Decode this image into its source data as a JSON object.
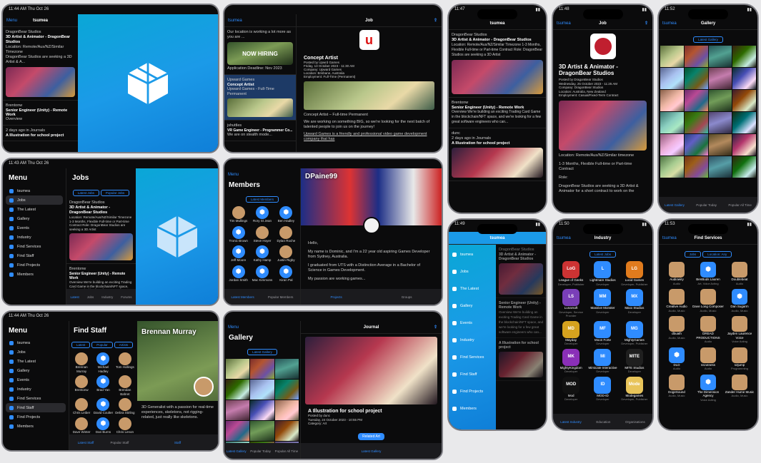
{
  "app": {
    "name": "tsumea",
    "accent": "#2f8cff",
    "ipad_time": "11:44 AM",
    "ipad_date": "Thu Oct 26",
    "jobs_time": "11:43 AM"
  },
  "feed": {
    "back": "Menu",
    "title": "tsumea",
    "job_author": "DragonBear Studios",
    "job_time": "1 day ago in Jobs",
    "job_title": "3D Artist & Animator - DragonBear Studios",
    "job_snip1": "Location: Remote/Aus/NZ/Similar Timezone",
    "job_snip2": "1-3 Months, Flexible Full-time or Part-time Contract",
    "job_snip3": "Role:",
    "job_snip4": "DragonBear Studios are seeking a 3D Artist",
    "job_snip5": "DragonBear Studios are seeking a 3D Artist & A...",
    "job2_author": "Brentonw",
    "job2_time": "1 day ago in Jobs",
    "job2_title": "Senior Engineer (Unity) - Remote Work",
    "job2_snip": "Overview",
    "job2_snip2": "We're building an exciting Trading Card Game in the blockchain/NFT space, and we're looking for a few great software engineers who can...",
    "illus_time": "2 days ago in Journals",
    "illus_title": "A Illustration for school project"
  },
  "job_detail": {
    "back": "tsumea",
    "title": "Job",
    "heading": "Concept Artist",
    "posted": "Posted by Upwrd Games",
    "date": "Friday, 13 October 2023 - 11:30 AM",
    "company": "Company: Upward Games",
    "location": "Location: Brisbane, Australia",
    "type": "Role Type: Full-Time",
    "employment": "Employment: Full-Time (Permanent)",
    "exp": "Experience: Senior",
    "line1": "Concept Artist – Full-time Permanent",
    "line2": "We are working on something BIG, so we're looking for the next batch of talented people to join us on the journey!",
    "line3": "Upward Games is a friendly and professional video game development company that has"
  },
  "job_feed_mid": {
    "snip1": "Our location is working a lot more as you are ...",
    "hiring": "NOW HIRING",
    "app_title": "Application Deadline: Nov 2023",
    "app_author": "hopepupp",
    "concept_title": "Concept Artist",
    "concept_sub": "Upward Games",
    "concept_snip": "Upward Games - Full-Time Permanent",
    "vr_author": "jshuttles",
    "vr_title": "VR Game Engineer - Programmer Co...",
    "vr_snip": "We are on stealth mode..."
  },
  "phone_feed": {
    "time": "11:47",
    "title": "tsumea",
    "job_author": "DragonBear Studios",
    "job_time": "1 day ago in Jobs",
    "job_title": "3D Artist & Animator - DragonBear Studios",
    "job_snip": "Location: Remote/Aus/NZ/Similar Timezone  1-3 Months, Flexible Full-time or Part-time Contract  Role:  DragonBear Studios are seeking a 3D Artist",
    "job2_author": "Brentonw",
    "job2_time": "1 day ago in Jobs",
    "job2_title": "Senior Engineer (Unity) - Remote Work",
    "job2_snip": "Overview  We're building an exciting Trading Card Game in the blockchain/NFT space, and we're looking for a few great software engineers who can...",
    "illus_author": "dunc",
    "illus_time": "2 days ago in Journals",
    "illus_title": "A Illustration for school project",
    "foot": "Jobs"
  },
  "phone_job": {
    "time": "11:48",
    "back": "tsumea",
    "title": "Job",
    "heading": "3D Artist & Animator - DragonBear Studios",
    "posted": "Posted by DragonBear Studios",
    "date": "Wednesday, 25 October 2023 - 11:25 AM",
    "company": "Company: DragonBear Studios",
    "location": "Location: Australia, New Zealand",
    "duration": "Duration: 1-3 Months",
    "employment": "Employment: Casual/Fixed-Term Contract",
    "skills": "Skills: 3D Art, Animation",
    "exp": "Experience: Mid-Level, Junior, Senior",
    "l1": "Location: Remote/Aus/NZ/Similar timezone",
    "l2": "1-3 Months, Flexible Full-time or Part-time Contract",
    "l3": "Role:",
    "l4": "DragonBear Studios are seeking a 3D Artist & Animator for a short contract to work on the"
  },
  "phone_gallery": {
    "time": "11:52",
    "back": "tsumea",
    "title": "Gallery",
    "seg": "Latest Gallery",
    "tabs": [
      "Latest Gallery",
      "Popular Today",
      "Popular All Time"
    ]
  },
  "ipad_menu": {
    "title": "Menu",
    "items": [
      "tsumea",
      "Jobs",
      "The Latest",
      "Gallery",
      "Events",
      "Industry",
      "Find Services",
      "Find Staff",
      "Find Projects",
      "Members"
    ]
  },
  "jobs_list": {
    "title": "Jobs",
    "segs": [
      "Latest Jobs",
      "Popular Jobs"
    ],
    "author": "DragonBear Studios",
    "job_title": "3D Artist & Animator - DragonBear Studios",
    "snip": "Location: Remote/Aus/NZ/Similar Timezone  1-3 Months, Flexible Full-time or Part-time Contract  Role:  DragonBear Studios are seeking a 3D Artist",
    "author2": "Brentonw",
    "job2_title": "Senior Engineer (Unity) - Remote Work",
    "snip2": "Overview  We're building an exciting Trading Card Game in the blockchain/NFT space, and we're looking for a few great software engineers",
    "tabs": [
      "Latest",
      "Jobs",
      "Industry",
      "Forums",
      "Education"
    ]
  },
  "members": {
    "back": "Menu",
    "title": "Members",
    "seg": "Latest Members",
    "people": [
      "Tim Mullings",
      "Rory St Jean",
      "Ben Hadley",
      "Tronic Brown",
      "Steve Hoyer",
      "Dylan Roche",
      "Jeff Moore",
      "Kathy Hamp",
      "Justin Rigby",
      "Jordan Smith",
      "Mac Kimmons",
      "Kiran Pal"
    ],
    "hero_name": "DPaine99",
    "hello": "Hello,",
    "bio1": "My name is Dominic, and I'm a 22 year old aspiring Games Developer from Sydney, Australia.",
    "bio2": "I graduated from UTS with a Distinction Average in a Bachelor of Science in Games Development.",
    "bio3": "My passion are working games...",
    "tabs": [
      "Latest Members",
      "Popular Members",
      "Projects",
      "Groups"
    ]
  },
  "phone_menu": {
    "time": "11:49",
    "title": "tsumea",
    "items": [
      "tsumea",
      "Jobs",
      "The Latest",
      "Gallery",
      "Events",
      "Industry",
      "Find Services",
      "Find Staff",
      "Find Projects",
      "Members"
    ]
  },
  "phone_industry": {
    "time": "11:50",
    "back": "tsumea",
    "title": "Industry",
    "seg": "Latest Jobs",
    "items": [
      {
        "name": "League of Geeks",
        "sub": "Developer, Publisher",
        "logo": "LoG"
      },
      {
        "name": "Lightmare Studios",
        "sub": "Developer",
        "logo": "L"
      },
      {
        "name": "Lucid Games",
        "sub": "Developer, Publisher",
        "logo": "LG"
      },
      {
        "name": "Lunarsoft",
        "sub": "Developer, Service Provider",
        "logo": "LS"
      },
      {
        "name": "Massive Monster",
        "sub": "Developer",
        "logo": "MM"
      },
      {
        "name": "Maxx Studios",
        "sub": "Developer",
        "logo": "MX"
      },
      {
        "name": "Mayday",
        "sub": "Developer",
        "logo": "MD"
      },
      {
        "name": "Moon Forte",
        "sub": "Developer",
        "logo": "MF"
      },
      {
        "name": "MightyGames",
        "sub": "Developer, Publisher",
        "logo": "MG"
      },
      {
        "name": "MightyKingdom",
        "sub": "Developer",
        "logo": "MK"
      },
      {
        "name": "Mimicate Interactive",
        "sub": "Developer",
        "logo": "MI"
      },
      {
        "name": "MITE Studios",
        "sub": "Developer",
        "logo": "MITE"
      },
      {
        "name": "Mod",
        "sub": "Developer",
        "logo": "MOD"
      },
      {
        "name": "MOD-ID",
        "sub": "Developer",
        "logo": "ID"
      },
      {
        "name": "Modegames",
        "sub": "Developer, Publisher",
        "logo": "Mode"
      }
    ],
    "tabs": [
      "Latest Industry",
      "Education",
      "Organisations"
    ]
  },
  "find_staff": {
    "title": "Find Staff",
    "segs": [
      "Latest",
      "Popular",
      "Artists",
      "Audio"
    ],
    "people": [
      "Brennan Murray",
      "Michael Hadley",
      "Tom Hollings",
      "Brentonw",
      "Brad Yan",
      "Brendan Bahret",
      "Chris Leiber",
      "David Coulter",
      "Debra Stirling",
      "Dave Winter",
      "Dan Burns",
      "Chris Lenon"
    ],
    "hero_name": "Brennan Murray",
    "bio": "3D Generalist with a passion for real-time experiences, skeletons, not rigging-related, just really like skeletons.",
    "tabs": [
      "Latest Staff",
      "Popular Staff",
      "Staff"
    ],
    "menu": [
      "tsumea",
      "Jobs",
      "The Latest",
      "Gallery",
      "Events",
      "Industry",
      "Find Services",
      "Find Staff",
      "Find Projects",
      "Members"
    ]
  },
  "ipad_gallery": {
    "back": "Menu",
    "title": "Gallery",
    "seg": "Latest Gallery",
    "center": "Journal",
    "art_title": "A Illustration for school project",
    "art_by": "Posted by dunc",
    "art_date": "Tuesday, 24 October 2023 - 10:55 PM",
    "art_cat": "Category: Art",
    "reply": "Related Art",
    "tabs": [
      "Latest Gallery",
      "Popular Today",
      "Popular All Time"
    ]
  },
  "find_services": {
    "time": "11:53",
    "back": "tsumea",
    "title": "Find Services",
    "segs": [
      "Jobs",
      "Location: Any"
    ],
    "items": [
      {
        "name": "Audiowiry",
        "sub": "Audio"
      },
      {
        "name": "BenBuds Lauren",
        "sub": "Art, Voice Acting"
      },
      {
        "name": "Doublebeat",
        "sub": "Audio"
      },
      {
        "name": "Creative Audio",
        "sub": "Audio, Music"
      },
      {
        "name": "Dave Long Composer",
        "sub": "Audio, Music"
      },
      {
        "name": "Dan Sugarm",
        "sub": "Audio, Music"
      },
      {
        "name": "dbuath",
        "sub": "Audio, Music"
      },
      {
        "name": "DREAD PRODUCTIONS",
        "sub": "Audio"
      },
      {
        "name": "Jayden Laurence Voice",
        "sub": "Voice Acting"
      },
      {
        "name": "DLD",
        "sub": "Audio"
      },
      {
        "name": "sszutness",
        "sub": "Audio"
      },
      {
        "name": "s2jump",
        "sub": "Programming"
      },
      {
        "name": "DogeSound",
        "sub": "Audio, Music"
      },
      {
        "name": "The Dimension Agency",
        "sub": "Voice Acting"
      },
      {
        "name": "Zander Hume Music",
        "sub": "Audio, Music"
      }
    ]
  }
}
